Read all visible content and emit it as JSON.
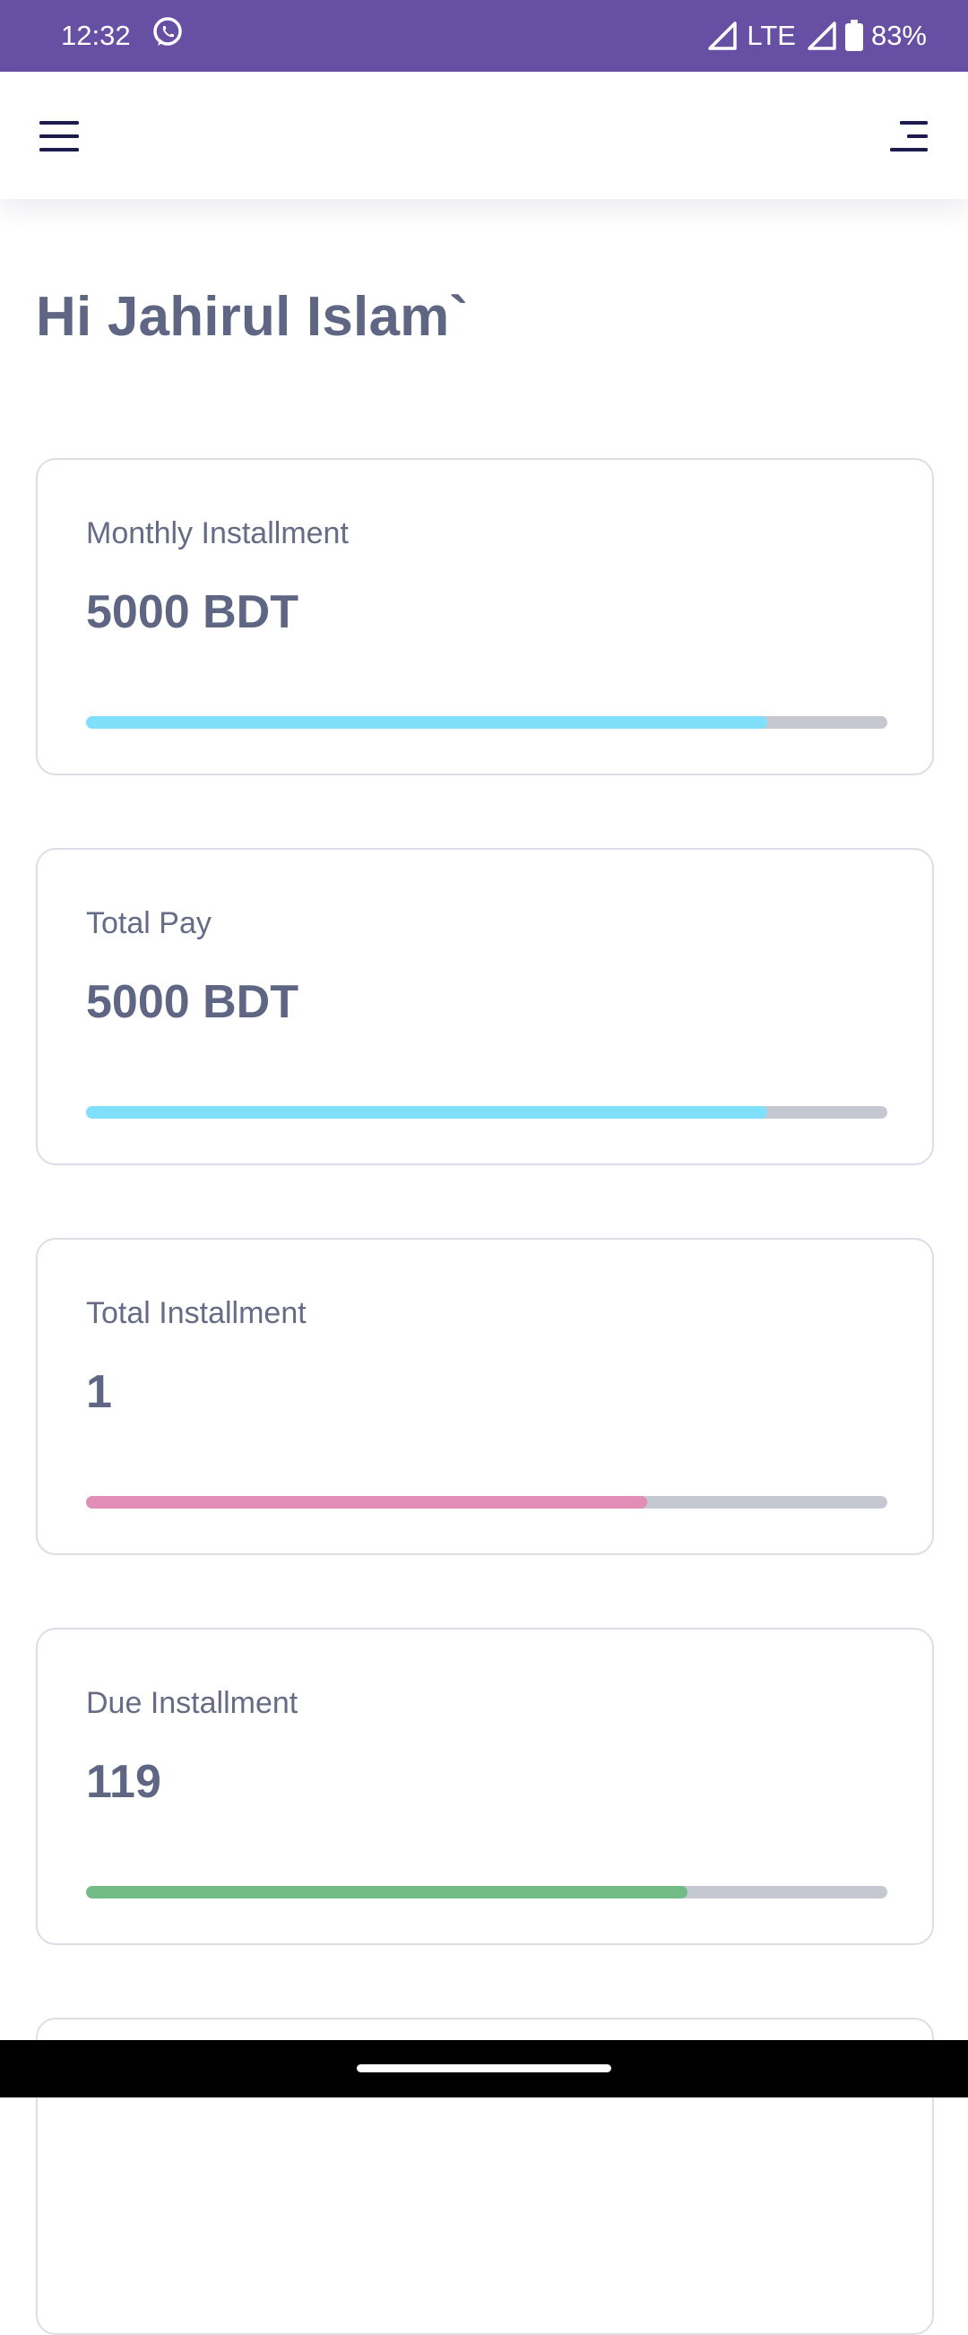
{
  "status_bar": {
    "time": "12:32",
    "network": "LTE",
    "battery": "83%",
    "icons": [
      "whatsapp-icon",
      "signal-icon",
      "signal-icon",
      "battery-icon"
    ]
  },
  "header": {
    "left_icon": "hamburger-menu-icon",
    "right_icon": "align-right-menu-icon"
  },
  "greeting": "Hi Jahirul Islam`",
  "cards": [
    {
      "label": "Monthly Installment",
      "value": "5000 BDT",
      "progress": 0.85,
      "color": "#80e0fb"
    },
    {
      "label": "Total Pay",
      "value": "5000 BDT",
      "progress": 0.85,
      "color": "#80e0fb"
    },
    {
      "label": "Total Installment",
      "value": "1",
      "progress": 0.7,
      "color": "#e18db6"
    },
    {
      "label": "Due Installment",
      "value": "119",
      "progress": 0.75,
      "color": "#72bc88"
    }
  ],
  "colors": {
    "status_bar": "#6750a4",
    "heading_text": "#5f6683",
    "card_border": "#dcdde6",
    "progress_track": "#c6c8d1"
  }
}
